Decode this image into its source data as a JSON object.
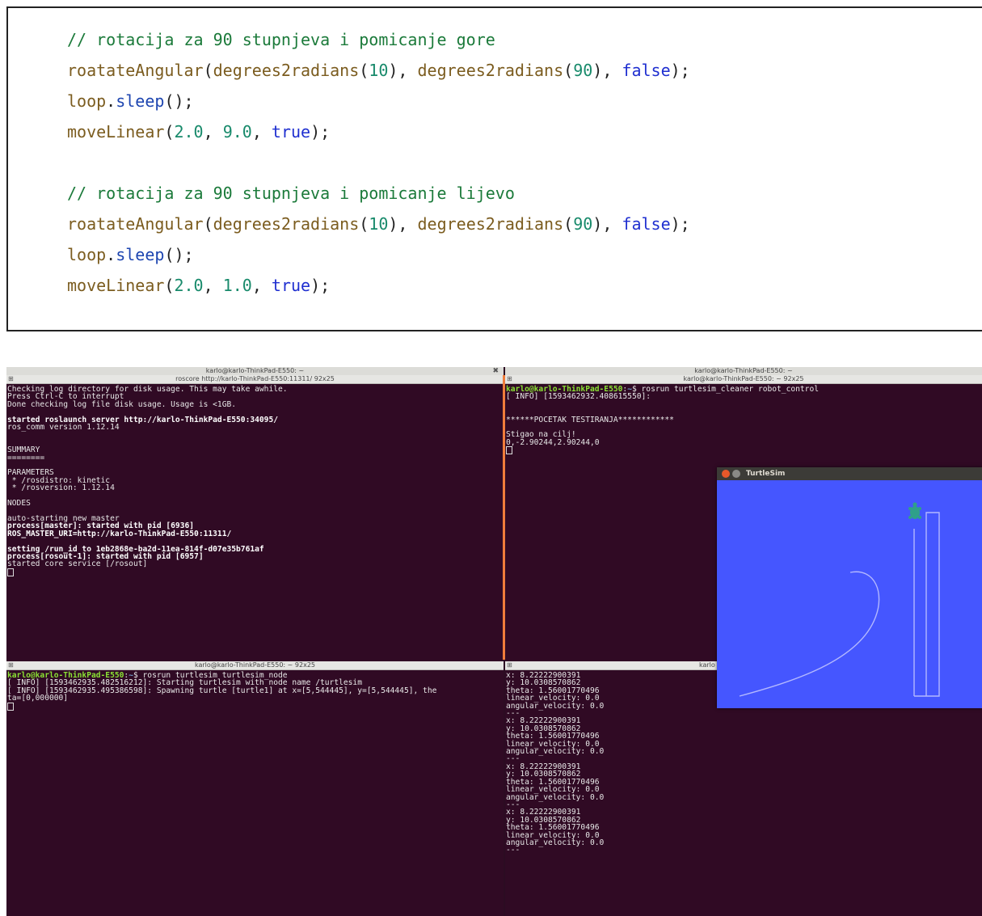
{
  "code_lines": [
    [
      {
        "t": "// rotacija za 90 stupnjeva i pomicanje gore",
        "c": "cm"
      }
    ],
    [
      {
        "t": "roatateAngular",
        "c": "fn"
      },
      {
        "t": "(",
        "c": "pl"
      },
      {
        "t": "degrees2radians",
        "c": "fn"
      },
      {
        "t": "(",
        "c": "pl"
      },
      {
        "t": "10",
        "c": "num"
      },
      {
        "t": "), ",
        "c": "pl"
      },
      {
        "t": "degrees2radians",
        "c": "fn"
      },
      {
        "t": "(",
        "c": "pl"
      },
      {
        "t": "90",
        "c": "num"
      },
      {
        "t": "), ",
        "c": "pl"
      },
      {
        "t": "false",
        "c": "kw"
      },
      {
        "t": ");",
        "c": "pl"
      }
    ],
    [
      {
        "t": "loop",
        "c": "fn"
      },
      {
        "t": ".",
        "c": "pl"
      },
      {
        "t": "sleep",
        "c": "id"
      },
      {
        "t": "();",
        "c": "pl"
      }
    ],
    [
      {
        "t": "moveLinear",
        "c": "fn"
      },
      {
        "t": "(",
        "c": "pl"
      },
      {
        "t": "2.0",
        "c": "num"
      },
      {
        "t": ", ",
        "c": "pl"
      },
      {
        "t": "9.0",
        "c": "num"
      },
      {
        "t": ", ",
        "c": "pl"
      },
      {
        "t": "true",
        "c": "kw"
      },
      {
        "t": ");",
        "c": "pl"
      }
    ],
    [],
    [
      {
        "t": "// rotacija za 90 stupnjeva i pomicanje lijevo",
        "c": "cm"
      }
    ],
    [
      {
        "t": "roatateAngular",
        "c": "fn"
      },
      {
        "t": "(",
        "c": "pl"
      },
      {
        "t": "degrees2radians",
        "c": "fn"
      },
      {
        "t": "(",
        "c": "pl"
      },
      {
        "t": "10",
        "c": "num"
      },
      {
        "t": "), ",
        "c": "pl"
      },
      {
        "t": "degrees2radians",
        "c": "fn"
      },
      {
        "t": "(",
        "c": "pl"
      },
      {
        "t": "90",
        "c": "num"
      },
      {
        "t": "), ",
        "c": "pl"
      },
      {
        "t": "false",
        "c": "kw"
      },
      {
        "t": ");",
        "c": "pl"
      }
    ],
    [
      {
        "t": "loop",
        "c": "fn"
      },
      {
        "t": ".",
        "c": "pl"
      },
      {
        "t": "sleep",
        "c": "id"
      },
      {
        "t": "();",
        "c": "pl"
      }
    ],
    [
      {
        "t": "moveLinear",
        "c": "fn"
      },
      {
        "t": "(",
        "c": "pl"
      },
      {
        "t": "2.0",
        "c": "num"
      },
      {
        "t": ", ",
        "c": "pl"
      },
      {
        "t": "1.0",
        "c": "num"
      },
      {
        "t": ", ",
        "c": "pl"
      },
      {
        "t": "true",
        "c": "kw"
      },
      {
        "t": ");",
        "c": "pl"
      }
    ]
  ],
  "window_left_title": "karlo@karlo-ThinkPad-E550: ~",
  "window_right_title": "karlo@karlo-ThinkPad-E550: ~",
  "window_close_glyph": "✖",
  "term_roscore": {
    "title": "roscore http://karlo-ThinkPad-E550:11311/ 92x25",
    "lines": [
      [
        {
          "t": "Checking log directory for disk usage. This may take awhile."
        }
      ],
      [
        {
          "t": "Press Ctrl-C to interrupt"
        }
      ],
      [
        {
          "t": "Done checking log file disk usage. Usage is <1GB."
        }
      ],
      [],
      [
        {
          "t": "started roslaunch server http://karlo-ThinkPad-E550:34095/",
          "s": "b"
        }
      ],
      [
        {
          "t": "ros_comm version 1.12.14"
        }
      ],
      [],
      [],
      [
        {
          "t": "SUMMARY"
        }
      ],
      [
        {
          "t": "========"
        }
      ],
      [],
      [
        {
          "t": "PARAMETERS"
        }
      ],
      [
        {
          "t": " * /rosdistro: kinetic"
        }
      ],
      [
        {
          "t": " * /rosversion: 1.12.14"
        }
      ],
      [],
      [
        {
          "t": "NODES"
        }
      ],
      [],
      [
        {
          "t": "auto-starting new master"
        }
      ],
      [
        {
          "t": "process[master]: started with pid [6936]",
          "s": "b"
        }
      ],
      [
        {
          "t": "ROS_MASTER_URI=http://karlo-ThinkPad-E550:11311/",
          "s": "b"
        }
      ],
      [],
      [
        {
          "t": "setting /run_id to 1eb2868e-ba2d-11ea-814f-d07e35b761af",
          "s": "b"
        }
      ],
      [
        {
          "t": "process[rosout-1]: started with pid [6957]",
          "s": "b"
        }
      ],
      [
        {
          "t": "started core service [/rosout]"
        }
      ]
    ]
  },
  "term_control": {
    "title": "karlo@karlo-ThinkPad-E550: ~ 92x25",
    "lines": [
      [
        {
          "t": "karlo@karlo-ThinkPad-E550",
          "s": "pr"
        },
        {
          "t": ":"
        },
        {
          "t": "~",
          "s": "pp"
        },
        {
          "t": "$ rosrun turtlesim_cleaner robot_control"
        }
      ],
      [
        {
          "t": "[ INFO] [1593462932.408615550]:"
        }
      ],
      [],
      [],
      [
        {
          "t": "******POCETAK TESTIRANJA************"
        }
      ],
      [],
      [
        {
          "t": "Stigao na cilj!"
        }
      ],
      [
        {
          "t": "0,-2.90244,2.90244,0"
        }
      ]
    ]
  },
  "term_node": {
    "title": "karlo@karlo-ThinkPad-E550: ~ 92x25",
    "lines": [
      [
        {
          "t": "karlo@karlo-ThinkPad-E550",
          "s": "pr"
        },
        {
          "t": ":"
        },
        {
          "t": "~",
          "s": "pp"
        },
        {
          "t": "$ rosrun turtlesim turtlesim_node"
        }
      ],
      [
        {
          "t": "[ INFO] [1593462935.482516212]: Starting turtlesim with node name /turtlesim"
        }
      ],
      [
        {
          "t": "[ INFO] [1593462935.495386598]: Spawning turtle [turtle1] at x=[5,544445], y=[5,544445], the"
        }
      ],
      [
        {
          "t": "ta=[0,000000]"
        }
      ]
    ]
  },
  "term_pose": {
    "title": "karlo",
    "lines": [
      [
        {
          "t": "x: 8.22222900391"
        }
      ],
      [
        {
          "t": "y: 10.0308570862"
        }
      ],
      [
        {
          "t": "theta: 1.56001770496"
        }
      ],
      [
        {
          "t": "linear_velocity: 0.0"
        }
      ],
      [
        {
          "t": "angular_velocity: 0.0"
        }
      ],
      [
        {
          "t": "---"
        }
      ],
      [
        {
          "t": "x: 8.22222900391"
        }
      ],
      [
        {
          "t": "y: 10.0308570862"
        }
      ],
      [
        {
          "t": "theta: 1.56001770496"
        }
      ],
      [
        {
          "t": "linear_velocity: 0.0"
        }
      ],
      [
        {
          "t": "angular_velocity: 0.0"
        }
      ],
      [
        {
          "t": "---"
        }
      ],
      [
        {
          "t": "x: 8.22222900391"
        }
      ],
      [
        {
          "t": "y: 10.0308570862"
        }
      ],
      [
        {
          "t": "theta: 1.56001770496"
        }
      ],
      [
        {
          "t": "linear_velocity: 0.0"
        }
      ],
      [
        {
          "t": "angular_velocity: 0.0"
        }
      ],
      [
        {
          "t": "---"
        }
      ],
      [
        {
          "t": "x: 8.22222900391"
        }
      ],
      [
        {
          "t": "y: 10.0308570862"
        }
      ],
      [
        {
          "t": "theta: 1.56001770496"
        }
      ],
      [
        {
          "t": "linear_velocity: 0.0"
        }
      ],
      [
        {
          "t": "angular_velocity: 0.0"
        }
      ],
      [
        {
          "t": "---"
        }
      ]
    ]
  },
  "turtlesim": {
    "title": "TurtleSim",
    "background": "#4556ff",
    "pen_color": "#b3b8ff",
    "turtle_color": "#2fa08a"
  },
  "colors": {
    "terminal_bg": "#300a24",
    "prompt_user": "#8ae234",
    "prompt_path": "#729fcf",
    "divider": "#f07c3b"
  }
}
